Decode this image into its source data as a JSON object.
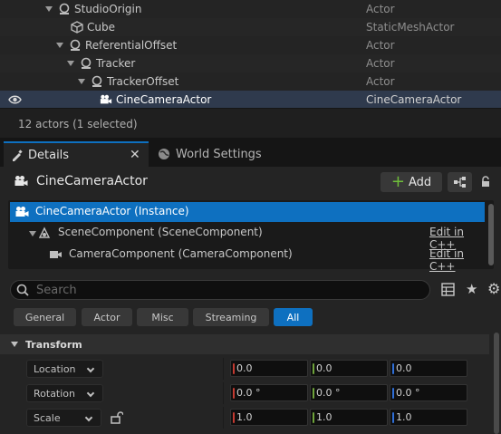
{
  "colors": {
    "accent": "#0e70c0",
    "x_axis": "#c43a31",
    "y_axis": "#6ea33a",
    "z_axis": "#2f6fd8"
  },
  "outliner": {
    "rows": [
      {
        "name": "StudioOrigin",
        "type": "Actor",
        "icon": "actor-icon"
      },
      {
        "name": "Cube",
        "type": "StaticMeshActor",
        "icon": "static-mesh-icon"
      },
      {
        "name": "ReferentialOffset",
        "type": "Actor",
        "icon": "actor-icon"
      },
      {
        "name": "Tracker",
        "type": "Actor",
        "icon": "actor-icon"
      },
      {
        "name": "TrackerOffset",
        "type": "Actor",
        "icon": "actor-icon"
      },
      {
        "name": "CineCameraActor",
        "type": "CineCameraActor",
        "icon": "camera-icon"
      }
    ],
    "status": "12 actors (1 selected)"
  },
  "tabs": {
    "details": "Details",
    "world_settings": "World Settings"
  },
  "details": {
    "actor_name": "CineCameraActor",
    "add_label": "Add",
    "components": {
      "instance": "CineCameraActor (Instance)",
      "scene": "SceneComponent (SceneComponent)",
      "camera": "CameraComponent (CameraComponent)",
      "edit_cpp": "Edit in C++"
    },
    "search_placeholder": "Search",
    "filters": [
      "General",
      "Actor",
      "Misc",
      "Streaming",
      "All"
    ],
    "section_title": "Transform",
    "transform": {
      "location": {
        "label": "Location",
        "x": "0.0",
        "y": "0.0",
        "z": "0.0"
      },
      "rotation": {
        "label": "Rotation",
        "x": "0.0 °",
        "y": "0.0 °",
        "z": "0.0 °"
      },
      "scale": {
        "label": "Scale",
        "x": "1.0",
        "y": "1.0",
        "z": "1.0"
      }
    }
  }
}
